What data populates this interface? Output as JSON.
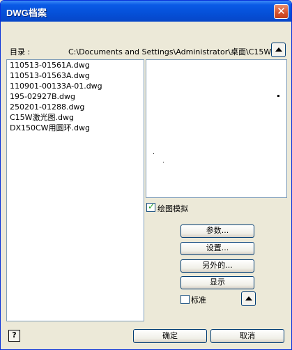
{
  "window": {
    "title": "DWG档案",
    "close_glyph": "✕"
  },
  "directory": {
    "label": "目录 :",
    "path": "C:\\Documents and Settings\\Administrator\\桌面\\C15W"
  },
  "files": [
    "110513-01561A.dwg",
    "110513-01563A.dwg",
    "110901-00133A-01.dwg",
    "195-02927B.dwg",
    "250201-01288.dwg",
    "C15W激光图.dwg",
    "DX150CW用圆环.dwg"
  ],
  "options": {
    "draw_simulation_label": "绘图模拟",
    "draw_simulation_checked": true,
    "standard_label": "标准",
    "standard_checked": false
  },
  "buttons": {
    "params": "参数...",
    "settings": "设置...",
    "other": "另外的...",
    "display": "显示",
    "ok": "确定",
    "cancel": "取消",
    "help": "?"
  },
  "icons": {
    "up": "up-arrow-icon",
    "help": "help-icon"
  }
}
